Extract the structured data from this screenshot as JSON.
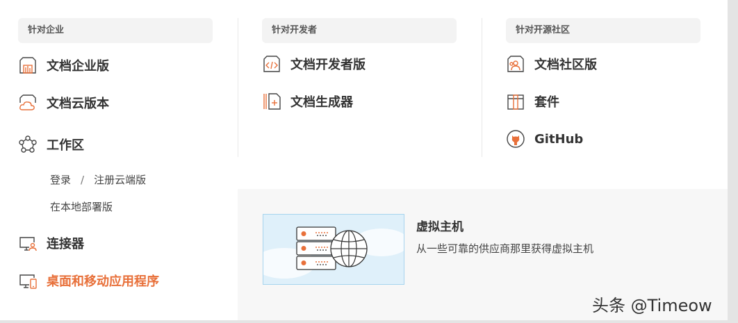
{
  "enterprise": {
    "header": "针对企业",
    "items": [
      {
        "label": "文档企业版",
        "icon": "enterprise-building-icon"
      },
      {
        "label": "文档云版本",
        "icon": "cloud-doc-icon"
      },
      {
        "label": "工作区",
        "icon": "workspace-network-icon"
      }
    ],
    "workspace_links": {
      "login": "登录",
      "separator": "/",
      "register": "注册云端版",
      "onpremise": "在本地部署版"
    },
    "connectors": {
      "label": "连接器",
      "icon": "connector-monitor-icon"
    },
    "desktop": {
      "label": "桌面和移动应用程序",
      "icon": "desktop-mobile-icon"
    }
  },
  "developers": {
    "header": "针对开发者",
    "items": [
      {
        "label": "文档开发者版",
        "icon": "code-doc-icon"
      },
      {
        "label": "文档生成器",
        "icon": "doc-builder-icon"
      }
    ]
  },
  "community": {
    "header": "针对开源社区",
    "items": [
      {
        "label": "文档社区版",
        "icon": "community-doc-icon"
      },
      {
        "label": "套件",
        "icon": "bundle-box-icon"
      },
      {
        "label": "GitHub",
        "icon": "github-icon"
      }
    ]
  },
  "feature": {
    "title": "虚拟主机",
    "description": "从一些可靠的供应商那里获得虚拟主机",
    "image": "server-globe-illustration"
  },
  "watermark": "头条 @Timeow",
  "colors": {
    "accent": "#e8703a",
    "header_bg": "#f3f3f3",
    "feature_bg": "#f7f7f7",
    "text": "#333333"
  }
}
